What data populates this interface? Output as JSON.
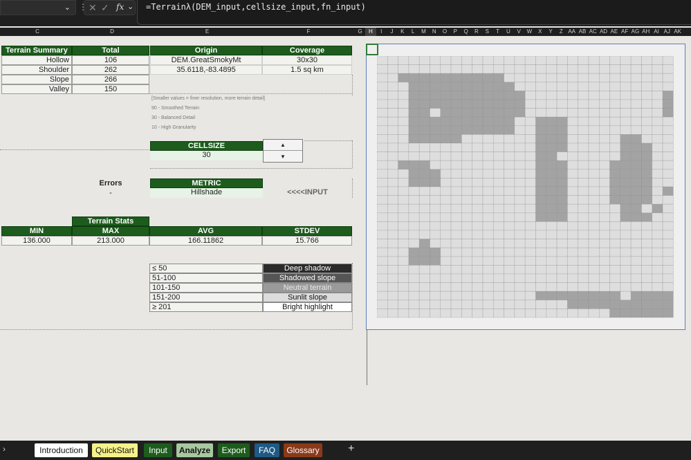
{
  "formula_bar": {
    "formula": "=Terrainλ(DEM_input,cellsize_input,fn_input)",
    "fx_label": "fx"
  },
  "columns": [
    "C",
    "D",
    "E",
    "F",
    "G",
    "H",
    "I",
    "J",
    "K",
    "L",
    "M",
    "N",
    "O",
    "P",
    "Q",
    "R",
    "S",
    "T",
    "U",
    "V",
    "W",
    "X",
    "Y",
    "Z",
    "AA",
    "AB",
    "AC",
    "AD",
    "AE",
    "AF",
    "AG",
    "AH",
    "AI",
    "AJ",
    "AK"
  ],
  "terrain_summary": {
    "header": "Terrain Summary",
    "total_header": "Total",
    "rows": [
      {
        "label": "Hollow",
        "total": "106"
      },
      {
        "label": "Shoulder",
        "total": "262"
      },
      {
        "label": "Slope",
        "total": "266"
      },
      {
        "label": "Valley",
        "total": "150"
      }
    ]
  },
  "origin": {
    "origin_header": "Origin",
    "coverage_header": "Coverage",
    "name": "DEM.GreatSmokyMt",
    "grid": "30x30",
    "coords": "35.6118,-83.4895",
    "area": "1.5 sq km"
  },
  "notes": [
    "[Smaller values = finer resolution, more terrain detail]",
    "90 - Smoothed Terrain",
    "30 - Balanced Detail",
    "10 - High Granularity"
  ],
  "cellsize": {
    "header": "CELLSIZE",
    "value": "30",
    "up": "▲",
    "down": "▼"
  },
  "errors": {
    "label": "Errors",
    "value": "-"
  },
  "metric": {
    "header": "METRIC",
    "value": "Hillshade",
    "input_hint": "<<<<INPUT"
  },
  "terrain_stats": {
    "title": "Terrain Stats",
    "headers": [
      "MIN",
      "MAX",
      "AVG",
      "STDEV"
    ],
    "values": [
      "136.000",
      "213.000",
      "166.11862",
      "15.766"
    ]
  },
  "legend": [
    {
      "range": "≤ 50",
      "label": "Deep shadow",
      "color": "#2b2b2b",
      "text_color": "#ffffff"
    },
    {
      "range": "51-100",
      "label": "Shadowed slope",
      "color": "#555555",
      "text_color": "#ffffff"
    },
    {
      "range": "101-150",
      "label": "Neutral terrain",
      "color": "#9a9a9a",
      "text_color": "#e8e8e8"
    },
    {
      "range": "151-200",
      "label": "Sunlit slope",
      "color": "#dcdcdc",
      "text_color": "#111111"
    },
    {
      "range": "≥ 201",
      "label": "Bright highlight",
      "color": "#ffffff",
      "text_color": "#111111"
    }
  ],
  "heightmap": {
    "rows": [
      "..............................",
      "..............................",
      "..##########..................",
      "...##########.................",
      "...###########.............#..",
      "...###########.............##.",
      "...##.########.............###",
      "...##########..###.............",
      "...##########..###.............",
      "...#####.......###.....##......",
      "...............###.....###.....",
      "...............##......###.....",
      "..###..........###....####.....",
      "...###.........###....####.....",
      "...###.........###....####.....",
      "...............###....####.#...",
      "...............###....####.....",
      "...............###.....##.#....",
      "...............###.....###.....",
      "...............................",
      "...............................",
      "....#..........................",
      "...###.........................",
      "...###.........................",
      "...............................",
      "...............................",
      "...............................",
      "...............########.#####..",
      "..................##########...",
      "......................######..."
    ],
    "dark_color": "#a3a3a3",
    "light_color": "#dedede"
  },
  "tabs": [
    {
      "label": "Introduction",
      "bg": "#ffffff",
      "color": "#111111"
    },
    {
      "label": "QuickStart",
      "bg": "#f6f28a",
      "color": "#111111"
    },
    {
      "label": "Input",
      "bg": "#1d5c1d",
      "color": "#ffffff"
    },
    {
      "label": "Analyze",
      "bg": "#a8c8a0",
      "color": "#111111"
    },
    {
      "label": "Export",
      "bg": "#1d5c1d",
      "color": "#ffffff"
    },
    {
      "label": "FAQ",
      "bg": "#1f5a85",
      "color": "#ffffff"
    },
    {
      "label": "Glossary",
      "bg": "#8a3a1a",
      "color": "#ffffff"
    }
  ],
  "add_tab": "+"
}
